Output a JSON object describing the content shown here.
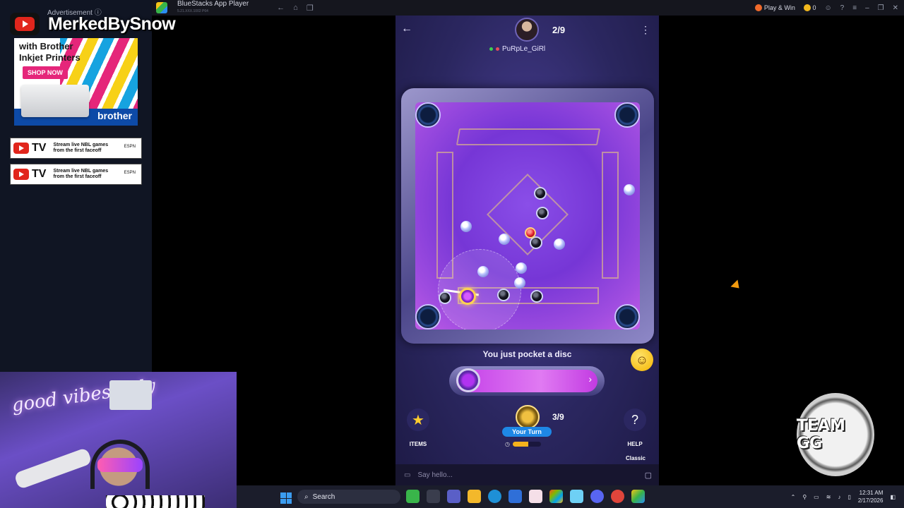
{
  "bluestacks": {
    "title": "BlueStacks App Player",
    "version": "5.21.XXX.1002 P64",
    "play_win_label": "Play & Win",
    "coins": "0",
    "nav_icons": [
      "back-icon",
      "home-icon",
      "multi-window-icon"
    ]
  },
  "sidebar": {
    "ad_label": "Advertisement ⓘ",
    "channel_name": "MerkedBySnow",
    "brother_ad": {
      "headline_1": "with Brother",
      "headline_2": "Inkjet Printers",
      "cta": "SHOP NOW",
      "brand": "brother"
    },
    "yt_tv_ads": [
      {
        "tv": "TV",
        "line1": "Stream live NBL games",
        "line2": "from the first faceoff",
        "partner": "ESPN"
      },
      {
        "tv": "TV",
        "line1": "Stream live NBL games",
        "line2": "from the first faceoff",
        "partner": "ESPN"
      }
    ]
  },
  "webcam": {
    "neon_sign": "good vibes only"
  },
  "game": {
    "opponent": {
      "name": "PuRpLe_GiRl",
      "score": "2/9"
    },
    "status_message": "You just pocket a disc",
    "player": {
      "turn_label": "Your Turn",
      "score": "3/9",
      "timer_remaining": 0.55
    },
    "items_label": "ITEMS",
    "help_label": "HELP",
    "help_glyph": "?",
    "mode_label": "Classic",
    "chat_placeholder": "Say hello...",
    "colors": {
      "board": "#7636d6",
      "striker_ring": "#ffd34f",
      "queen": "#e01f2b",
      "turn_badge": "#1e88e5"
    }
  },
  "overlay": {
    "team_badge": "TEAM GG"
  },
  "taskbar": {
    "search_label": "Search",
    "time": "12:31 AM",
    "date": "2/17/2026"
  }
}
